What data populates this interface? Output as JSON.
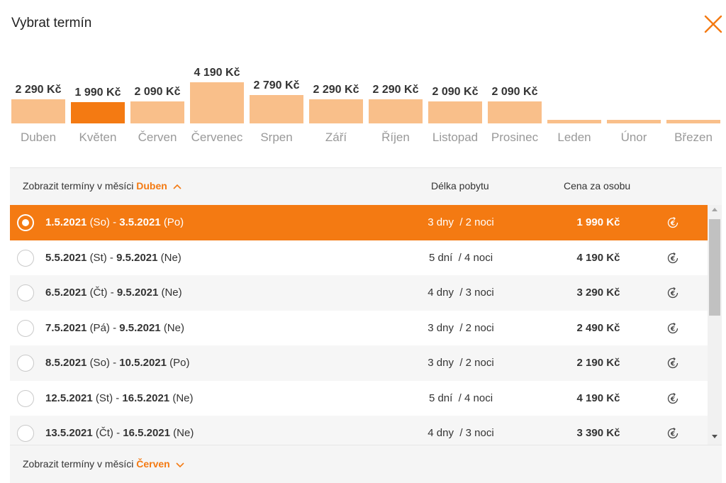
{
  "dialog": {
    "title": "Vybrat termín"
  },
  "colors": {
    "accent": "#f47a12",
    "bar": "#f9bf8a",
    "empty_bar": "#f9bf8a",
    "icon": "#f47a12"
  },
  "icons": {
    "close": "close-icon",
    "euro": "euro-icon",
    "chevron_up": "chevron-up-icon",
    "chevron_down": "chevron-down-icon"
  },
  "months": [
    {
      "label": "Duben",
      "price": "2 290 Kč",
      "value": 2290,
      "selected": false
    },
    {
      "label": "Květen",
      "price": "1 990 Kč",
      "value": 1990,
      "selected": true
    },
    {
      "label": "Červen",
      "price": "2 090 Kč",
      "value": 2090,
      "selected": false
    },
    {
      "label": "Červenec",
      "price": "4 190 Kč",
      "value": 4190,
      "selected": false
    },
    {
      "label": "Srpen",
      "price": "2 790 Kč",
      "value": 2790,
      "selected": false
    },
    {
      "label": "Září",
      "price": "2 290 Kč",
      "value": 2290,
      "selected": false
    },
    {
      "label": "Říjen",
      "price": "2 290 Kč",
      "value": 2290,
      "selected": false
    },
    {
      "label": "Listopad",
      "price": "2 090 Kč",
      "value": 2090,
      "selected": false
    },
    {
      "label": "Prosinec",
      "price": "2 090 Kč",
      "value": 2090,
      "selected": false
    },
    {
      "label": "Leden",
      "price": "",
      "value": null,
      "selected": false
    },
    {
      "label": "Únor",
      "price": "",
      "value": null,
      "selected": false
    },
    {
      "label": "Březen",
      "price": "",
      "value": null,
      "selected": false
    }
  ],
  "table": {
    "header": {
      "toggle_prefix": "Zobrazit termíny v měsíci",
      "toggle_month": "Duben",
      "col_stay": "Délka pobytu",
      "col_price": "Cena za osobu"
    },
    "footer": {
      "toggle_prefix": "Zobrazit termíny v měsíci",
      "toggle_month": "Červen"
    },
    "rows": [
      {
        "from": "1.5.2021",
        "from_day": "(So)",
        "to": "3.5.2021",
        "to_day": "(Po)",
        "days": "3 dny",
        "nights": "/ 2 noci",
        "price": "1 990 Kč",
        "selected": true
      },
      {
        "from": "5.5.2021",
        "from_day": "(St)",
        "to": "9.5.2021",
        "to_day": "(Ne)",
        "days": "5 dní",
        "nights": "/ 4 noci",
        "price": "4 190 Kč",
        "selected": false
      },
      {
        "from": "6.5.2021",
        "from_day": "(Čt)",
        "to": "9.5.2021",
        "to_day": "(Ne)",
        "days": "4 dny",
        "nights": "/ 3 noci",
        "price": "3 290 Kč",
        "selected": false
      },
      {
        "from": "7.5.2021",
        "from_day": "(Pá)",
        "to": "9.5.2021",
        "to_day": "(Ne)",
        "days": "3 dny",
        "nights": "/ 2 noci",
        "price": "2 490 Kč",
        "selected": false
      },
      {
        "from": "8.5.2021",
        "from_day": "(So)",
        "to": "10.5.2021",
        "to_day": "(Po)",
        "days": "3 dny",
        "nights": "/ 2 noci",
        "price": "2 190 Kč",
        "selected": false
      },
      {
        "from": "12.5.2021",
        "from_day": "(St)",
        "to": "16.5.2021",
        "to_day": "(Ne)",
        "days": "5 dní",
        "nights": "/ 4 noci",
        "price": "4 190 Kč",
        "selected": false
      },
      {
        "from": "13.5.2021",
        "from_day": "(Čt)",
        "to": "16.5.2021",
        "to_day": "(Ne)",
        "days": "4 dny",
        "nights": "/ 3 noci",
        "price": "3 390 Kč",
        "selected": false
      }
    ]
  }
}
